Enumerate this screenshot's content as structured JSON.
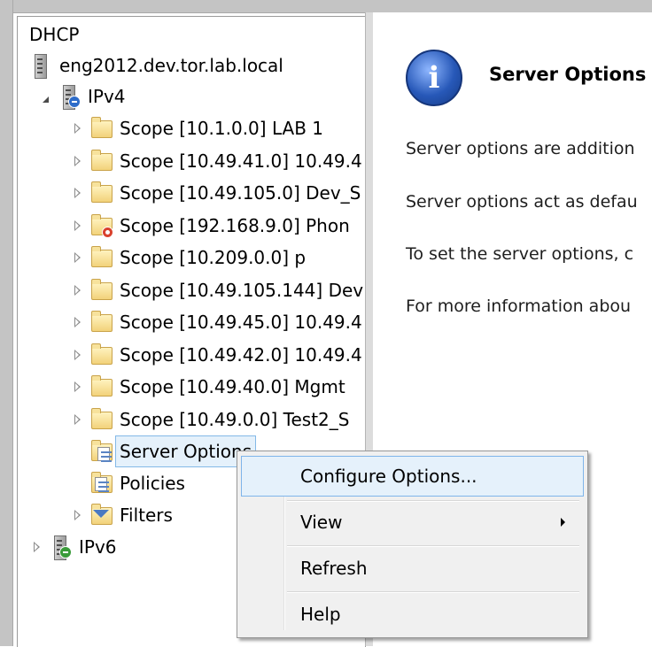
{
  "tree": {
    "root": "DHCP",
    "server": "eng2012.dev.tor.lab.local",
    "ipv4": "IPv4",
    "scopes": [
      {
        "label": "Scope [10.1.0.0] LAB 1",
        "badge": false
      },
      {
        "label": "Scope [10.49.41.0] 10.49.4",
        "badge": false
      },
      {
        "label": "Scope [10.49.105.0] Dev_S",
        "badge": false
      },
      {
        "label": "Scope [192.168.9.0] Phon",
        "badge": true
      },
      {
        "label": "Scope [10.209.0.0] p",
        "badge": false
      },
      {
        "label": "Scope [10.49.105.144] Dev",
        "badge": false
      },
      {
        "label": "Scope [10.49.45.0] 10.49.4",
        "badge": false
      },
      {
        "label": "Scope [10.49.42.0] 10.49.4",
        "badge": false
      },
      {
        "label": "Scope [10.49.40.0] Mgmt",
        "badge": false
      },
      {
        "label": "Scope [10.49.0.0] Test2_S",
        "badge": false
      }
    ],
    "server_options": "Server Options",
    "policies": "Policies",
    "filters": "Filters",
    "ipv6": "IPv6"
  },
  "details": {
    "title": "Server Options",
    "paragraphs": [
      "Server options are addition",
      "Server options act as defau",
      "To set the server options, c",
      "For more information abou"
    ]
  },
  "context_menu": {
    "items": [
      "Configure Options...",
      "View",
      "Refresh",
      "Help"
    ]
  },
  "icons": {
    "info": "i"
  }
}
